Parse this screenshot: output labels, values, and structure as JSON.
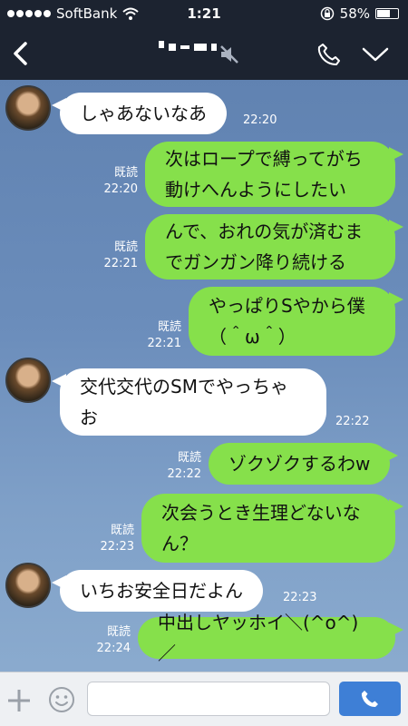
{
  "status_bar": {
    "carrier": "SoftBank",
    "time": "1:21",
    "battery_text": "58%",
    "battery_level": 0.58
  },
  "nav": {
    "contact_name": "",
    "back_icon": "chevron-left-icon",
    "mute_icon": "speaker-muted-icon",
    "call_icon": "phone-icon",
    "menu_icon": "chevron-down-icon"
  },
  "messages": [
    {
      "side": "in",
      "lines": [
        "しゃあないなあ"
      ],
      "time": "22:20"
    },
    {
      "side": "out",
      "read": "既読",
      "lines": [
        "次はロープで縛ってがち",
        "動けへんようにしたい"
      ],
      "time": "22:20"
    },
    {
      "side": "out",
      "read": "既読",
      "lines": [
        "んで、おれの気が済むま",
        "でガンガン降り続ける"
      ],
      "time": "22:21"
    },
    {
      "side": "out",
      "read": "既読",
      "lines": [
        "やっぱりSやから僕",
        "（＾ω＾）"
      ],
      "time": "22:21"
    },
    {
      "side": "in",
      "lines": [
        "交代交代のSMでやっちゃ",
        "お"
      ],
      "time": "22:22"
    },
    {
      "side": "out",
      "read": "既読",
      "lines": [
        "ゾクゾクするわw"
      ],
      "time": "22:22"
    },
    {
      "side": "out",
      "read": "既読",
      "lines": [
        "次会うとき生理どないな",
        "ん？"
      ],
      "time": "22:23"
    },
    {
      "side": "in",
      "lines": [
        "いちお安全日だよん"
      ],
      "time": "22:23"
    },
    {
      "side": "out",
      "read": "既読",
      "lines": [
        "中出しヤッホイ＼(^o^)／"
      ],
      "time": "22:24"
    }
  ],
  "input": {
    "placeholder": "",
    "value": ""
  },
  "colors": {
    "bar": "#1c2330",
    "outgoing_bubble": "#86e04b",
    "incoming_bubble": "#ffffff",
    "send_button": "#3e7fd6"
  }
}
